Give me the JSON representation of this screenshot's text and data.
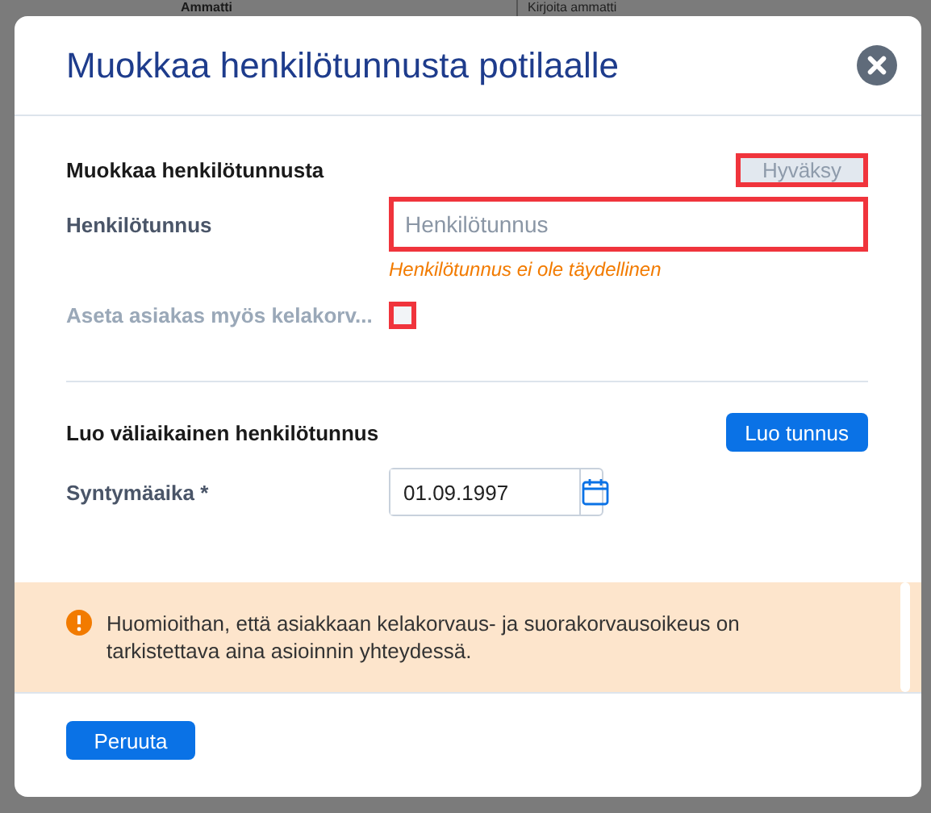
{
  "background": {
    "label": "Ammatti",
    "field_placeholder": "Kirjoita ammatti"
  },
  "dialog": {
    "title": "Muokkaa henkilötunnusta potilaalle"
  },
  "edit_section": {
    "heading": "Muokkaa henkilötunnusta",
    "accept_button": {
      "label": "Hyväksy",
      "disabled": true,
      "invalid": true
    },
    "id_field": {
      "label": "Henkilötunnus",
      "placeholder": "Henkilötunnus",
      "invalid": true,
      "error": "Henkilötunnus ei ole täydellinen"
    },
    "checkbox": {
      "label": "Aseta asiakas myös kelakorv...",
      "checked": false,
      "disabled": true,
      "invalid": true
    }
  },
  "temp_section": {
    "heading": "Luo väliaikainen henkilötunnus",
    "create_button": {
      "label": "Luo tunnus"
    },
    "birth_field": {
      "label": "Syntymäaika *",
      "value": "01.09.1997"
    }
  },
  "notice": {
    "text": "Huomioithan, että asiakkaan kelakorvaus- ja suorakorvausoikeus on tarkistettava aina asioinnin yhteydessä."
  },
  "footer": {
    "cancel_button": {
      "label": "Peruuta"
    }
  }
}
